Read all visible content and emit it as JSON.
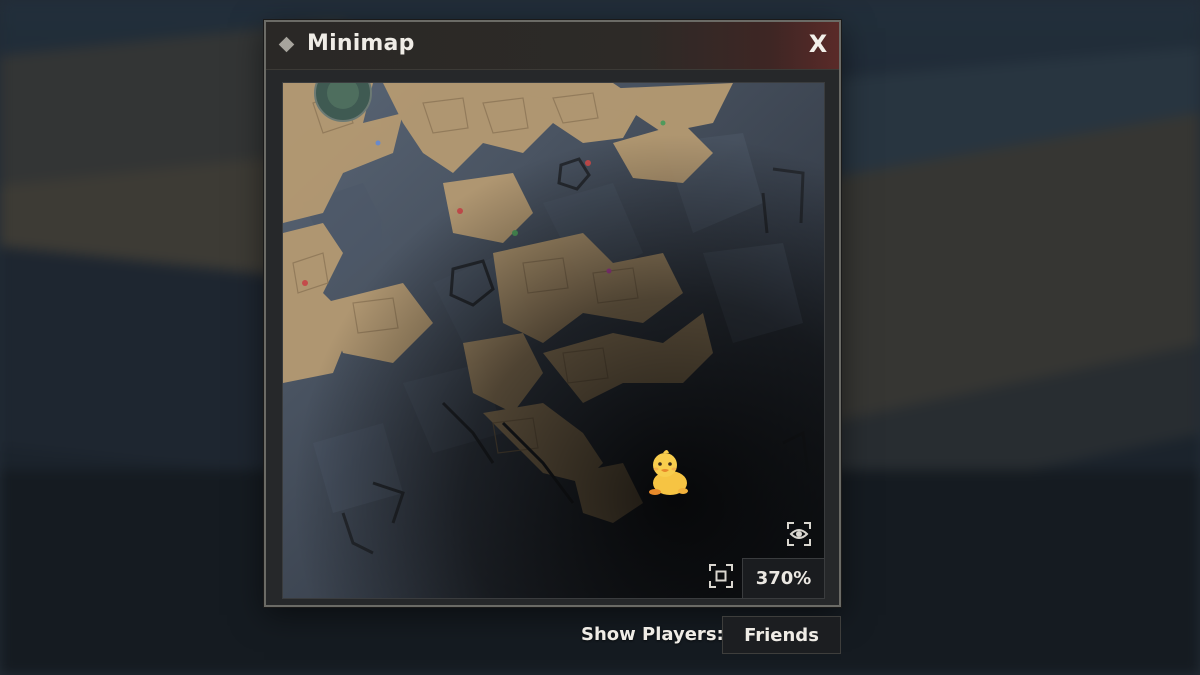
{
  "window": {
    "title": "Minimap",
    "close_label": "X"
  },
  "map": {
    "zoom_label": "370%",
    "player_icon": "duck-icon",
    "view_toggle_icon": "eye-icon",
    "recenter_icon": "recenter-icon"
  },
  "footer": {
    "show_players_label": "Show Players:",
    "show_players_value": "Friends"
  },
  "colors": {
    "land": "#b59a72",
    "water": "#4a5564",
    "accent_red": "#5a2a28"
  }
}
